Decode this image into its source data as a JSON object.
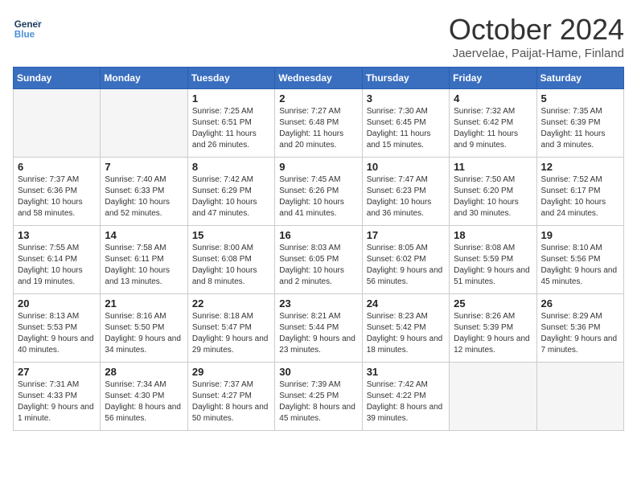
{
  "logo": {
    "line1": "General",
    "line2": "Blue"
  },
  "title": "October 2024",
  "location": "Jaervelae, Paijat-Hame, Finland",
  "days_of_week": [
    "Sunday",
    "Monday",
    "Tuesday",
    "Wednesday",
    "Thursday",
    "Friday",
    "Saturday"
  ],
  "weeks": [
    [
      {
        "day": "",
        "sunrise": "",
        "sunset": "",
        "daylight": "",
        "empty": true
      },
      {
        "day": "",
        "sunrise": "",
        "sunset": "",
        "daylight": "",
        "empty": true
      },
      {
        "day": "1",
        "sunrise": "Sunrise: 7:25 AM",
        "sunset": "Sunset: 6:51 PM",
        "daylight": "Daylight: 11 hours and 26 minutes."
      },
      {
        "day": "2",
        "sunrise": "Sunrise: 7:27 AM",
        "sunset": "Sunset: 6:48 PM",
        "daylight": "Daylight: 11 hours and 20 minutes."
      },
      {
        "day": "3",
        "sunrise": "Sunrise: 7:30 AM",
        "sunset": "Sunset: 6:45 PM",
        "daylight": "Daylight: 11 hours and 15 minutes."
      },
      {
        "day": "4",
        "sunrise": "Sunrise: 7:32 AM",
        "sunset": "Sunset: 6:42 PM",
        "daylight": "Daylight: 11 hours and 9 minutes."
      },
      {
        "day": "5",
        "sunrise": "Sunrise: 7:35 AM",
        "sunset": "Sunset: 6:39 PM",
        "daylight": "Daylight: 11 hours and 3 minutes."
      }
    ],
    [
      {
        "day": "6",
        "sunrise": "Sunrise: 7:37 AM",
        "sunset": "Sunset: 6:36 PM",
        "daylight": "Daylight: 10 hours and 58 minutes."
      },
      {
        "day": "7",
        "sunrise": "Sunrise: 7:40 AM",
        "sunset": "Sunset: 6:33 PM",
        "daylight": "Daylight: 10 hours and 52 minutes."
      },
      {
        "day": "8",
        "sunrise": "Sunrise: 7:42 AM",
        "sunset": "Sunset: 6:29 PM",
        "daylight": "Daylight: 10 hours and 47 minutes."
      },
      {
        "day": "9",
        "sunrise": "Sunrise: 7:45 AM",
        "sunset": "Sunset: 6:26 PM",
        "daylight": "Daylight: 10 hours and 41 minutes."
      },
      {
        "day": "10",
        "sunrise": "Sunrise: 7:47 AM",
        "sunset": "Sunset: 6:23 PM",
        "daylight": "Daylight: 10 hours and 36 minutes."
      },
      {
        "day": "11",
        "sunrise": "Sunrise: 7:50 AM",
        "sunset": "Sunset: 6:20 PM",
        "daylight": "Daylight: 10 hours and 30 minutes."
      },
      {
        "day": "12",
        "sunrise": "Sunrise: 7:52 AM",
        "sunset": "Sunset: 6:17 PM",
        "daylight": "Daylight: 10 hours and 24 minutes."
      }
    ],
    [
      {
        "day": "13",
        "sunrise": "Sunrise: 7:55 AM",
        "sunset": "Sunset: 6:14 PM",
        "daylight": "Daylight: 10 hours and 19 minutes."
      },
      {
        "day": "14",
        "sunrise": "Sunrise: 7:58 AM",
        "sunset": "Sunset: 6:11 PM",
        "daylight": "Daylight: 10 hours and 13 minutes."
      },
      {
        "day": "15",
        "sunrise": "Sunrise: 8:00 AM",
        "sunset": "Sunset: 6:08 PM",
        "daylight": "Daylight: 10 hours and 8 minutes."
      },
      {
        "day": "16",
        "sunrise": "Sunrise: 8:03 AM",
        "sunset": "Sunset: 6:05 PM",
        "daylight": "Daylight: 10 hours and 2 minutes."
      },
      {
        "day": "17",
        "sunrise": "Sunrise: 8:05 AM",
        "sunset": "Sunset: 6:02 PM",
        "daylight": "Daylight: 9 hours and 56 minutes."
      },
      {
        "day": "18",
        "sunrise": "Sunrise: 8:08 AM",
        "sunset": "Sunset: 5:59 PM",
        "daylight": "Daylight: 9 hours and 51 minutes."
      },
      {
        "day": "19",
        "sunrise": "Sunrise: 8:10 AM",
        "sunset": "Sunset: 5:56 PM",
        "daylight": "Daylight: 9 hours and 45 minutes."
      }
    ],
    [
      {
        "day": "20",
        "sunrise": "Sunrise: 8:13 AM",
        "sunset": "Sunset: 5:53 PM",
        "daylight": "Daylight: 9 hours and 40 minutes."
      },
      {
        "day": "21",
        "sunrise": "Sunrise: 8:16 AM",
        "sunset": "Sunset: 5:50 PM",
        "daylight": "Daylight: 9 hours and 34 minutes."
      },
      {
        "day": "22",
        "sunrise": "Sunrise: 8:18 AM",
        "sunset": "Sunset: 5:47 PM",
        "daylight": "Daylight: 9 hours and 29 minutes."
      },
      {
        "day": "23",
        "sunrise": "Sunrise: 8:21 AM",
        "sunset": "Sunset: 5:44 PM",
        "daylight": "Daylight: 9 hours and 23 minutes."
      },
      {
        "day": "24",
        "sunrise": "Sunrise: 8:23 AM",
        "sunset": "Sunset: 5:42 PM",
        "daylight": "Daylight: 9 hours and 18 minutes."
      },
      {
        "day": "25",
        "sunrise": "Sunrise: 8:26 AM",
        "sunset": "Sunset: 5:39 PM",
        "daylight": "Daylight: 9 hours and 12 minutes."
      },
      {
        "day": "26",
        "sunrise": "Sunrise: 8:29 AM",
        "sunset": "Sunset: 5:36 PM",
        "daylight": "Daylight: 9 hours and 7 minutes."
      }
    ],
    [
      {
        "day": "27",
        "sunrise": "Sunrise: 7:31 AM",
        "sunset": "Sunset: 4:33 PM",
        "daylight": "Daylight: 9 hours and 1 minute."
      },
      {
        "day": "28",
        "sunrise": "Sunrise: 7:34 AM",
        "sunset": "Sunset: 4:30 PM",
        "daylight": "Daylight: 8 hours and 56 minutes."
      },
      {
        "day": "29",
        "sunrise": "Sunrise: 7:37 AM",
        "sunset": "Sunset: 4:27 PM",
        "daylight": "Daylight: 8 hours and 50 minutes."
      },
      {
        "day": "30",
        "sunrise": "Sunrise: 7:39 AM",
        "sunset": "Sunset: 4:25 PM",
        "daylight": "Daylight: 8 hours and 45 minutes."
      },
      {
        "day": "31",
        "sunrise": "Sunrise: 7:42 AM",
        "sunset": "Sunset: 4:22 PM",
        "daylight": "Daylight: 8 hours and 39 minutes."
      },
      {
        "day": "",
        "sunrise": "",
        "sunset": "",
        "daylight": "",
        "empty": true
      },
      {
        "day": "",
        "sunrise": "",
        "sunset": "",
        "daylight": "",
        "empty": true
      }
    ]
  ]
}
